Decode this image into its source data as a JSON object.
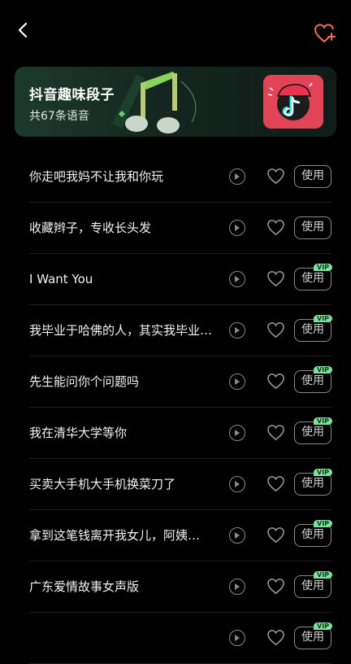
{
  "header": {
    "back_icon": "chevron-left-icon",
    "fav_icon": "heart-plus-icon",
    "accent": "#f26b5b"
  },
  "banner": {
    "title": "抖音趣味段子",
    "subtitle": "共67条语音",
    "logo_icon": "tiktok-logo-icon",
    "logo_bg": "#e04456"
  },
  "list": {
    "use_label": "使用",
    "vip_label": "VIP",
    "items": [
      {
        "text": "你走吧我妈不让我和你玩",
        "vip": false
      },
      {
        "text": "收藏辫子，专收长头发",
        "vip": false
      },
      {
        "text": "I Want You",
        "vip": true
      },
      {
        "text": "我毕业于哈佛的人，其实我毕业于…",
        "vip": true
      },
      {
        "text": "先生能问你个问题吗",
        "vip": true
      },
      {
        "text": "我在清华大学等你",
        "vip": true
      },
      {
        "text": "买卖大手机大手机换菜刀了",
        "vip": true
      },
      {
        "text": "拿到这笔钱离开我女儿，阿姨…",
        "vip": true
      },
      {
        "text": "广东爱情故事女声版",
        "vip": true
      },
      {
        "text": "",
        "vip": true
      }
    ]
  }
}
